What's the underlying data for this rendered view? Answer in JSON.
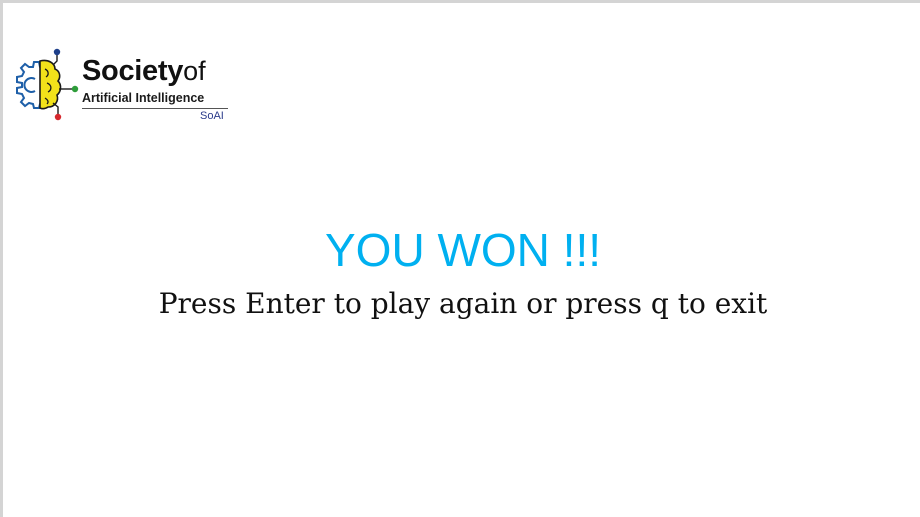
{
  "logo": {
    "name_bold": "Society",
    "name_light": "of",
    "subtitle": "Artificial Intelligence",
    "abbreviation": "SoAI",
    "icon": "gear-brain-circuit-icon",
    "colors": {
      "gear": "#1e5fa8",
      "brain": "#f2e21a",
      "node_blue": "#1e3f8a",
      "node_green": "#2e9d3a",
      "node_red": "#d6282e"
    }
  },
  "game_over": {
    "message": "YOU WON !!!",
    "message_color": "#00b0f0",
    "instructions": "Press Enter to play again or press q to exit"
  },
  "controls": {
    "play_again_key": "Enter",
    "exit_key": "q"
  }
}
